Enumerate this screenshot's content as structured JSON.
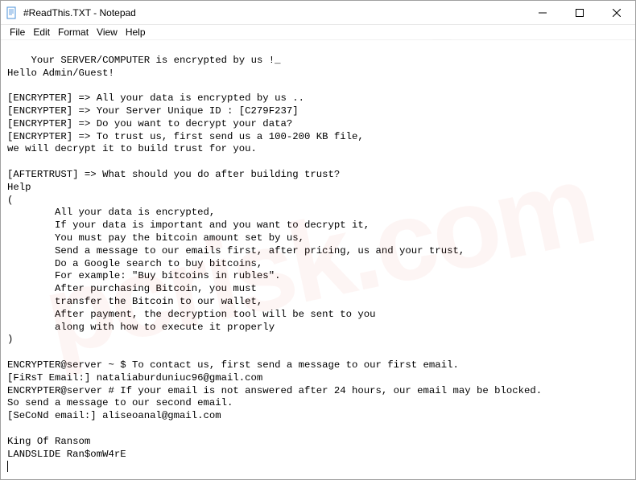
{
  "window": {
    "title": "#ReadThis.TXT - Notepad"
  },
  "menubar": {
    "items": [
      "File",
      "Edit",
      "Format",
      "View",
      "Help"
    ]
  },
  "content": {
    "text": "Your SERVER/COMPUTER is encrypted by us !_\nHello Admin/Guest!\n\n[ENCRYPTER] => All your data is encrypted by us ..\n[ENCRYPTER] => Your Server Unique ID : [C279F237]\n[ENCRYPTER] => Do you want to decrypt your data?\n[ENCRYPTER] => To trust us, first send us a 100-200 KB file,\nwe will decrypt it to build trust for you.\n\n[AFTERTRUST] => What should you do after building trust?\nHelp\n(\n        All your data is encrypted,\n        If your data is important and you want to decrypt it,\n        You must pay the bitcoin amount set by us,\n        Send a message to our emails first, after pricing, us and your trust,\n        Do a Google search to buy bitcoins,\n        For example: \"Buy bitcoins in rubles\".\n        After purchasing Bitcoin, you must\n        transfer the Bitcoin to our wallet,\n        After payment, the decryption tool will be sent to you\n        along with how to execute it properly\n)\n\nENCRYPTER@server ~ $ To contact us, first send a message to our first email.\n[FiRsT Email:] nataliaburduniuc96@gmail.com\nENCRYPTER@server # If your email is not answered after 24 hours, our email may be blocked.\nSo send a message to our second email.\n[SeCoNd email:] aliseoanal@gmail.com\n\nKing Of Ransom\nLANDSLIDE Ran$omW4rE"
  },
  "watermark": {
    "text": "pcrisk.com"
  }
}
